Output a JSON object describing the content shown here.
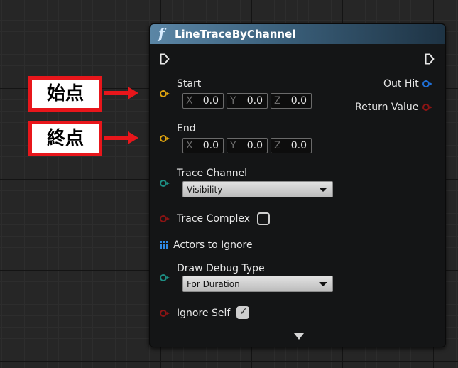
{
  "node": {
    "title": "LineTraceByChannel",
    "function_icon": "function-icon",
    "inputs": {
      "start": {
        "label": "Start",
        "x": "0.0",
        "y": "0.0",
        "z": "0.0"
      },
      "end": {
        "label": "End",
        "x": "0.0",
        "y": "0.0",
        "z": "0.0"
      },
      "trace_channel": {
        "label": "Trace Channel",
        "value": "Visibility"
      },
      "trace_complex": {
        "label": "Trace Complex",
        "checked": false
      },
      "actors_to_ignore": {
        "label": "Actors to Ignore"
      },
      "draw_debug_type": {
        "label": "Draw Debug Type",
        "value": "For Duration"
      },
      "ignore_self": {
        "label": "Ignore Self",
        "checked": true
      }
    },
    "outputs": {
      "out_hit": {
        "label": "Out Hit"
      },
      "return_value": {
        "label": "Return Value"
      }
    },
    "axis_labels": {
      "x": "X",
      "y": "Y",
      "z": "Z"
    }
  },
  "annotations": {
    "start_callout": "始点",
    "end_callout": "終点",
    "color": "#e8161b"
  },
  "pin_colors": {
    "vector": "#e0a40e",
    "enum": "#1e8f84",
    "bool": "#8c1414",
    "struct": "#1f6fd6",
    "array": "#2f8be8"
  }
}
